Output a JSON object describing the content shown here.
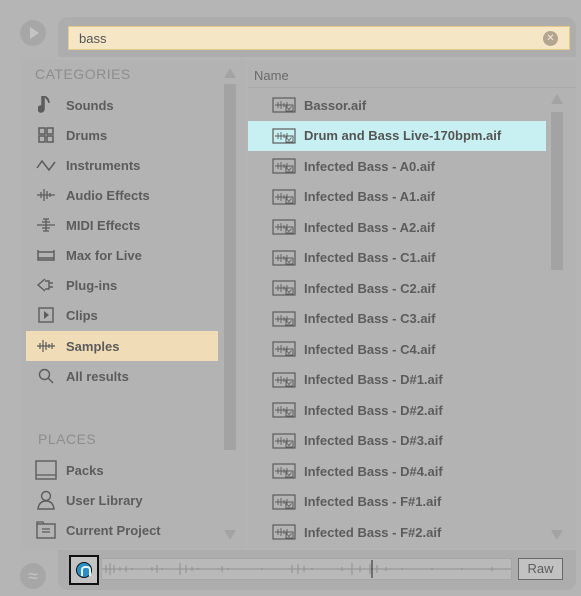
{
  "search": {
    "value": "bass"
  },
  "sidebar": {
    "categories_header": "CATEGORIES",
    "categories": [
      {
        "label": "Sounds",
        "icon": "note-icon"
      },
      {
        "label": "Drums",
        "icon": "drums-grid-icon"
      },
      {
        "label": "Instruments",
        "icon": "instrument-wave-icon"
      },
      {
        "label": "Audio Effects",
        "icon": "audio-effect-icon"
      },
      {
        "label": "MIDI Effects",
        "icon": "midi-effect-icon"
      },
      {
        "label": "Max for Live",
        "icon": "max-for-live-icon"
      },
      {
        "label": "Plug-ins",
        "icon": "plugin-icon"
      },
      {
        "label": "Clips",
        "icon": "clip-icon"
      },
      {
        "label": "Samples",
        "icon": "samples-icon",
        "selected": true
      },
      {
        "label": "All results",
        "icon": "search-icon"
      }
    ],
    "places_header": "PLACES",
    "places": [
      {
        "label": "Packs",
        "icon": "packs-icon"
      },
      {
        "label": "User Library",
        "icon": "user-icon"
      },
      {
        "label": "Current Project",
        "icon": "folder-icon"
      }
    ]
  },
  "main": {
    "column_header": "Name",
    "files": [
      "Bassor.aif",
      "Drum and Bass Live-170bpm.aif",
      "Infected Bass - A0.aif",
      "Infected Bass - A1.aif",
      "Infected Bass - A2.aif",
      "Infected Bass - C1.aif",
      "Infected Bass - C2.aif",
      "Infected Bass - C3.aif",
      "Infected Bass - C4.aif",
      "Infected Bass - D#1.aif",
      "Infected Bass - D#2.aif",
      "Infected Bass - D#3.aif",
      "Infected Bass - D#4.aif",
      "Infected Bass - F#1.aif",
      "Infected Bass - F#2.aif"
    ],
    "selected_index": 1
  },
  "preview": {
    "raw_label": "Raw"
  },
  "colors": {
    "background": "#b5b5b5",
    "search_fill": "#f5e6c6",
    "selected_category": "#f0dcb6",
    "selected_file": "#c8f0f2",
    "preview_button": "#2a8fc7"
  }
}
